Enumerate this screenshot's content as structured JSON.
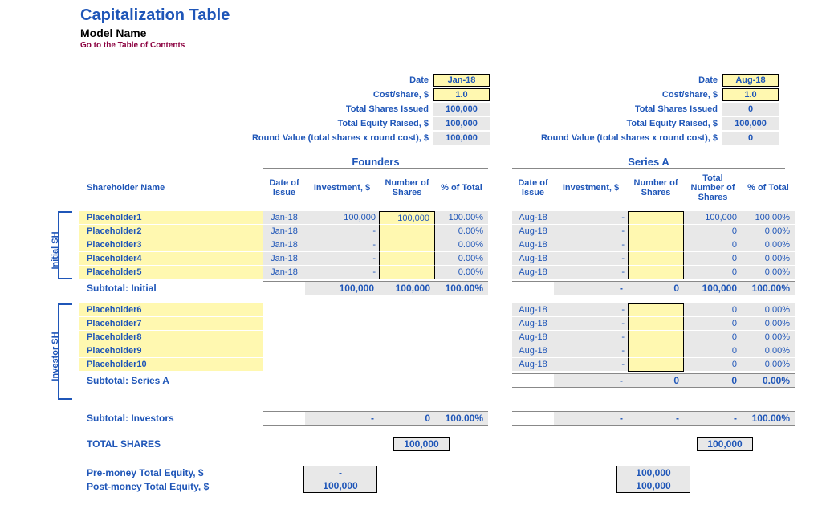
{
  "header": {
    "title": "Capitalization Table",
    "subtitle": "Model Name",
    "toc_link": "Go to the Table of Contents"
  },
  "summary_labels": {
    "date": "Date",
    "cost_share": "Cost/share, $",
    "total_shares": "Total Shares Issued",
    "total_equity": "Total Equity Raised, $",
    "round_value": "Round Value (total shares x round cost), $"
  },
  "founders_summary": {
    "date": "Jan-18",
    "cost_share": "1.0",
    "total_shares": "100,000",
    "total_equity": "100,000",
    "round_value": "100,000"
  },
  "seriesA_summary": {
    "date": "Aug-18",
    "cost_share": "1.0",
    "total_shares": "0",
    "total_equity": "100,000",
    "round_value": "0"
  },
  "round_labels": {
    "founders": "Founders",
    "seriesA": "Series A"
  },
  "col_headers": {
    "shareholder": "Shareholder Name",
    "date_of_issue": "Date of Issue",
    "investment": "Investment, $",
    "num_shares": "Number of Shares",
    "pct_total": "% of Total",
    "total_num_shares": "Total Number of Shares"
  },
  "sections": {
    "initial_label": "Initial SH",
    "investor_label": "Investor SH"
  },
  "initial_rows": [
    {
      "name": "Placeholder1",
      "f_date": "Jan-18",
      "f_inv": "100,000",
      "f_nos": "100,000",
      "f_pct": "100.00%",
      "s_date": "Aug-18",
      "s_inv": "-",
      "s_nos": "",
      "s_tns": "100,000",
      "s_pct": "100.00%"
    },
    {
      "name": "Placeholder2",
      "f_date": "Jan-18",
      "f_inv": "-",
      "f_nos": "",
      "f_pct": "0.00%",
      "s_date": "Aug-18",
      "s_inv": "-",
      "s_nos": "",
      "s_tns": "0",
      "s_pct": "0.00%"
    },
    {
      "name": "Placeholder3",
      "f_date": "Jan-18",
      "f_inv": "-",
      "f_nos": "",
      "f_pct": "0.00%",
      "s_date": "Aug-18",
      "s_inv": "-",
      "s_nos": "",
      "s_tns": "0",
      "s_pct": "0.00%"
    },
    {
      "name": "Placeholder4",
      "f_date": "Jan-18",
      "f_inv": "-",
      "f_nos": "",
      "f_pct": "0.00%",
      "s_date": "Aug-18",
      "s_inv": "-",
      "s_nos": "",
      "s_tns": "0",
      "s_pct": "0.00%"
    },
    {
      "name": "Placeholder5",
      "f_date": "Jan-18",
      "f_inv": "-",
      "f_nos": "",
      "f_pct": "0.00%",
      "s_date": "Aug-18",
      "s_inv": "-",
      "s_nos": "",
      "s_tns": "0",
      "s_pct": "0.00%"
    }
  ],
  "subtotal_initial": {
    "label": "Subtotal: Initial",
    "f_inv": "100,000",
    "f_nos": "100,000",
    "f_pct": "100.00%",
    "s_inv": "-",
    "s_nos": "0",
    "s_tns": "100,000",
    "s_pct": "100.00%"
  },
  "investor_rows": [
    {
      "name": "Placeholder6",
      "s_date": "Aug-18",
      "s_inv": "-",
      "s_nos": "",
      "s_tns": "0",
      "s_pct": "0.00%"
    },
    {
      "name": "Placeholder7",
      "s_date": "Aug-18",
      "s_inv": "-",
      "s_nos": "",
      "s_tns": "0",
      "s_pct": "0.00%"
    },
    {
      "name": "Placeholder8",
      "s_date": "Aug-18",
      "s_inv": "-",
      "s_nos": "",
      "s_tns": "0",
      "s_pct": "0.00%"
    },
    {
      "name": "Placeholder9",
      "s_date": "Aug-18",
      "s_inv": "-",
      "s_nos": "",
      "s_tns": "0",
      "s_pct": "0.00%"
    },
    {
      "name": "Placeholder10",
      "s_date": "Aug-18",
      "s_inv": "-",
      "s_nos": "",
      "s_tns": "0",
      "s_pct": "0.00%"
    }
  ],
  "subtotal_seriesA": {
    "label": "Subtotal: Series A",
    "s_inv": "-",
    "s_nos": "0",
    "s_tns": "0",
    "s_pct": "0.00%"
  },
  "subtotal_investors": {
    "label": "Subtotal: Investors",
    "f_inv": "-",
    "f_nos": "0",
    "f_pct": "100.00%",
    "s_inv": "-",
    "s_nos": "-",
    "s_tns": "-",
    "s_pct": "100.00%"
  },
  "total_shares": {
    "label": "TOTAL SHARES",
    "founders": "100,000",
    "seriesA": "100,000"
  },
  "equity": {
    "pre_label": "Pre-money Total Equity, $",
    "post_label": "Post-money Total Equity, $",
    "f_pre": "-",
    "f_post": "100,000",
    "s_pre": "100,000",
    "s_post": "100,000"
  }
}
